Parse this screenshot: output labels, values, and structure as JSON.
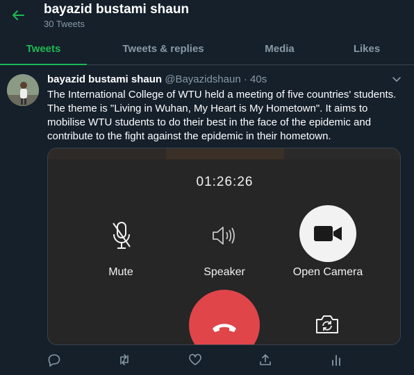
{
  "header": {
    "title": "bayazid bustami shaun",
    "subtitle": "30 Tweets",
    "back_icon": "arrow-left-icon"
  },
  "tabs": [
    {
      "label": "Tweets",
      "active": true
    },
    {
      "label": "Tweets & replies",
      "active": false
    },
    {
      "label": "Media",
      "active": false
    },
    {
      "label": "Likes",
      "active": false
    }
  ],
  "tweet": {
    "author_name": "bayazid bustami shaun",
    "handle": "@Bayazidshaun",
    "separator": "·",
    "time": "40s",
    "text": "The International College of WTU held a meeting of five countries' students. The theme is \"Living in Wuhan, My Heart is My Hometown\". It aims to mobilise WTU students to do their best in the face of the epidemic and contribute to the fight against the epidemic in their hometown."
  },
  "media": {
    "call_timer": "01:26:26",
    "controls": {
      "mute": "Mute",
      "speaker": "Speaker",
      "camera": "Open Camera"
    }
  },
  "actions": [
    "reply-icon",
    "retweet-icon",
    "like-icon",
    "share-icon",
    "analytics-icon"
  ],
  "colors": {
    "background": "#15202b",
    "accent": "#1db954",
    "muted_text": "#8899a6",
    "hangup": "#e0454a"
  }
}
